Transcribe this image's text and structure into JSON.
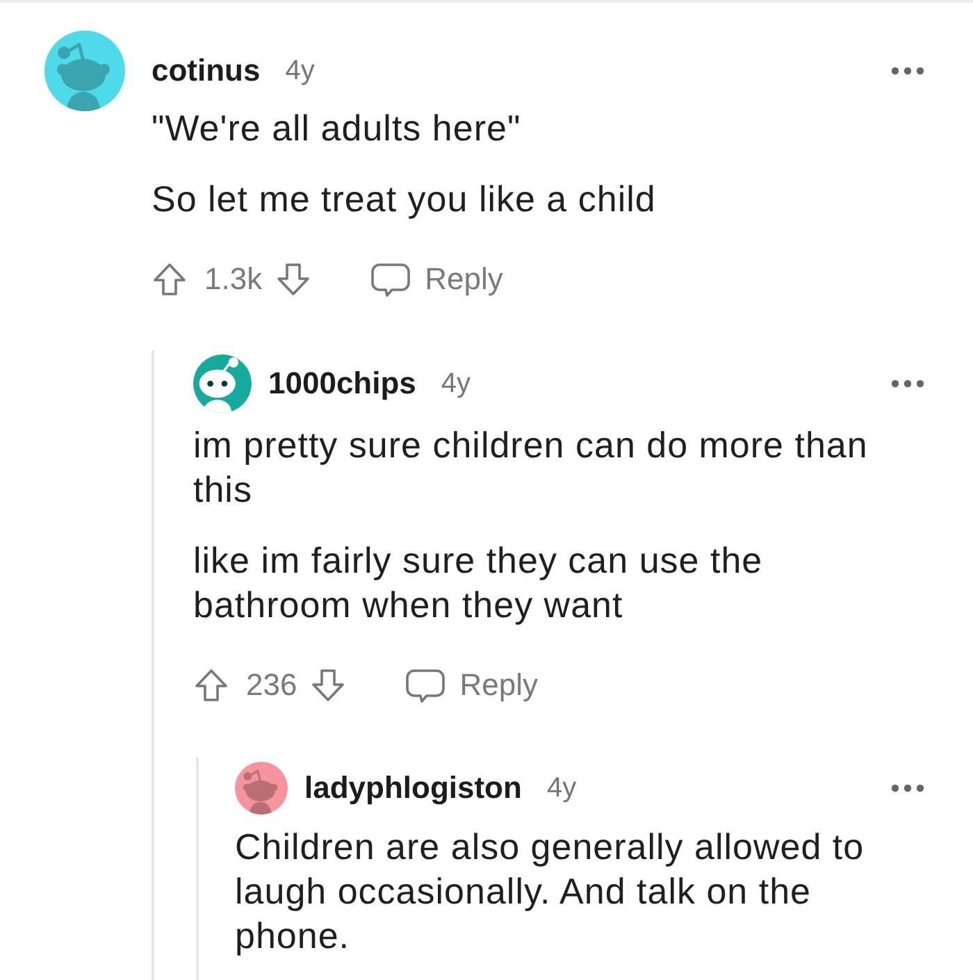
{
  "comments": [
    {
      "username": "cotinus",
      "age": "4y",
      "avatar": {
        "kind": "silhouette",
        "color": "#4ddbe9"
      },
      "body": [
        "\"We're all adults here\"",
        "So let me treat you like a child"
      ],
      "actions": {
        "score": "1.3k",
        "reply": "Reply"
      },
      "children": [
        {
          "username": "1000chips",
          "age": "4y",
          "avatar": {
            "kind": "face",
            "color": "#14aaa0"
          },
          "body": [
            "im pretty sure children can do more than this",
            "like im fairly sure they can use the bathroom when they want"
          ],
          "actions": {
            "score": "236",
            "reply": "Reply"
          },
          "children": [
            {
              "username": "ladyphlogiston",
              "age": "4y",
              "avatar": {
                "kind": "silhouette",
                "color": "#f5949c"
              },
              "body": [
                "Children are also generally allowed to laugh occasionally. And talk on the phone."
              ]
            }
          ]
        }
      ]
    }
  ]
}
